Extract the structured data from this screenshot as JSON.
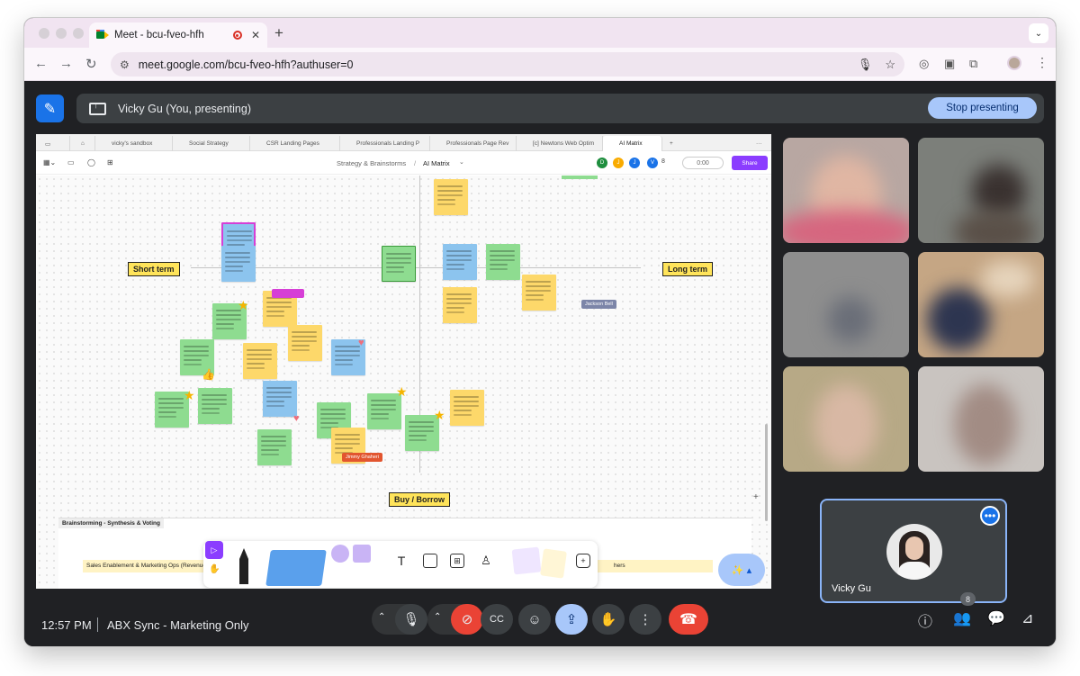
{
  "browser": {
    "tab_title": "Meet - bcu-fveo-hfh",
    "url": "meet.google.com/bcu-fveo-hfh?authuser=0"
  },
  "presenting": {
    "label": "Vicky Gu (You, presenting)",
    "stop_button": "Stop presenting"
  },
  "figjam": {
    "tabs": [
      "vicky's sandbox",
      "Social Strategy",
      "CSR Landing Pages",
      "Professionals Landing P",
      "Professionals Page Rev",
      "[c] Newtons Web Optim",
      "AI Matrix"
    ],
    "breadcrumb": "Strategy & Brainstorms",
    "file_name": "AI Matrix",
    "avatars": [
      {
        "letter": "D",
        "color": "#1e8e3e"
      },
      {
        "letter": "J",
        "color": "#f9ab00"
      },
      {
        "letter": "J",
        "color": "#1a73e8"
      },
      {
        "letter": "V",
        "color": "#1a73e8"
      }
    ],
    "viewer_count": "8",
    "timer": "0:00",
    "share_label": "Share",
    "axis_labels": {
      "left": "Short term",
      "right": "Long term",
      "bottom": "Buy / Borrow"
    },
    "cursor_names": [
      "Jackson Bell",
      "Jimmy Ghaheri"
    ],
    "section_title": "Brainstorming - Synthesis & Voting",
    "row_label": "Sales Enablement & Marketing Ops (Revenue",
    "row_label_right": "hers"
  },
  "participant_self": {
    "name": "Vicky Gu"
  },
  "bottom_bar": {
    "time": "12:57 PM",
    "meeting_name": "ABX Sync - Marketing Only",
    "people_count": "8"
  }
}
